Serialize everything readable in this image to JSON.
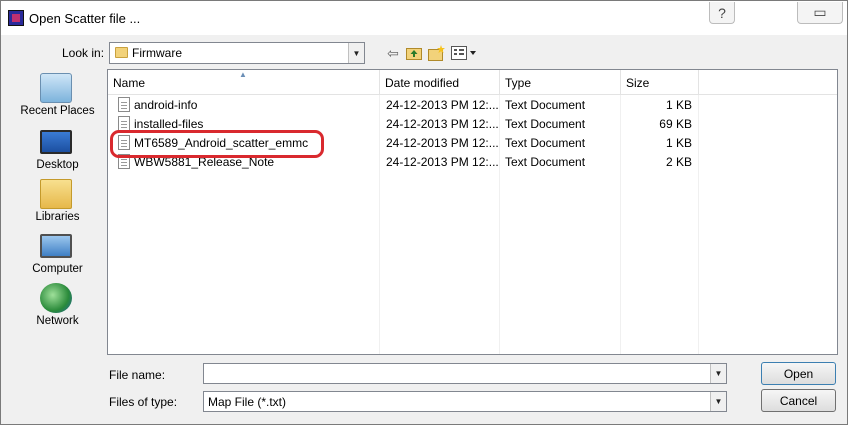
{
  "window": {
    "title": "Open Scatter file ...",
    "help_button": "?",
    "minimize_button": "▭"
  },
  "toolbar": {
    "look_in_label": "Look in:",
    "look_in_value": "Firmware",
    "back_icon": "back-arrow-icon",
    "up_icon": "up-folder-icon",
    "new_folder_icon": "new-folder-icon",
    "views_icon": "views-menu-icon"
  },
  "places": [
    {
      "label": "Recent Places",
      "icon": "recent-places-icon"
    },
    {
      "label": "Desktop",
      "icon": "desktop-icon"
    },
    {
      "label": "Libraries",
      "icon": "libraries-icon"
    },
    {
      "label": "Computer",
      "icon": "computer-icon"
    },
    {
      "label": "Network",
      "icon": "network-icon"
    }
  ],
  "file_list": {
    "columns": [
      "Name",
      "Date modified",
      "Type",
      "Size"
    ],
    "rows": [
      {
        "name": "android-info",
        "date": "24-12-2013 PM 12:...",
        "type": "Text Document",
        "size": "1 KB"
      },
      {
        "name": "installed-files",
        "date": "24-12-2013 PM 12:...",
        "type": "Text Document",
        "size": "69 KB"
      },
      {
        "name": "MT6589_Android_scatter_emmc",
        "date": "24-12-2013 PM 12:...",
        "type": "Text Document",
        "size": "1 KB"
      },
      {
        "name": "WBW5881_Release_Note",
        "date": "24-12-2013 PM 12:...",
        "type": "Text Document",
        "size": "2 KB"
      }
    ],
    "highlight_color": "#d9292e"
  },
  "bottom": {
    "file_name_label": "File name:",
    "file_name_value": "",
    "file_type_label": "Files of type:",
    "file_type_value": "Map File (*.txt)",
    "open_label": "Open",
    "cancel_label": "Cancel"
  }
}
